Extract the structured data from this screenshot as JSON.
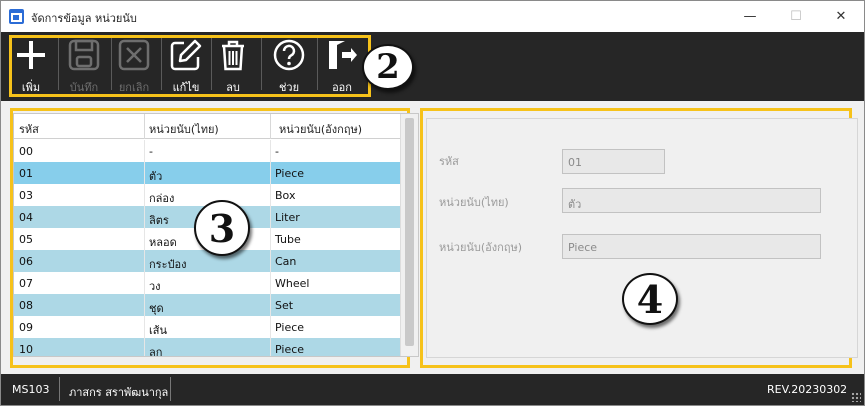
{
  "window": {
    "title": "จัดการข้อมูล หน่วยนับ",
    "minimize": "—",
    "maximize": "☐",
    "close": "✕"
  },
  "toolbar": [
    {
      "label": "เพิ่ม",
      "icon": "plus-icon",
      "enabled": true
    },
    {
      "label": "บันทึก",
      "icon": "save-icon",
      "enabled": false
    },
    {
      "label": "ยกเลิก",
      "icon": "cancel-icon",
      "enabled": false
    },
    {
      "label": "แก้ไข",
      "icon": "edit-icon",
      "enabled": true
    },
    {
      "label": "ลบ",
      "icon": "trash-icon",
      "enabled": true
    },
    {
      "label": "ช่วย",
      "icon": "help-icon",
      "enabled": true
    },
    {
      "label": "ออก",
      "icon": "exit-icon",
      "enabled": true
    }
  ],
  "callouts": {
    "c2": "2",
    "c3": "3",
    "c4": "4"
  },
  "grid": {
    "headers": [
      "รหัส",
      "หน่วยนับ(ไทย)",
      "หน่วยนับ(อังกฤษ)"
    ],
    "rows": [
      [
        "00",
        "-",
        "-"
      ],
      [
        "01",
        "ตัว",
        "Piece"
      ],
      [
        "03",
        "กล่อง",
        "Box"
      ],
      [
        "04",
        "ลิตร",
        "Liter"
      ],
      [
        "05",
        "หลอด",
        "Tube"
      ],
      [
        "06",
        "กระป๋อง",
        "Can"
      ],
      [
        "07",
        "วง",
        "Wheel"
      ],
      [
        "08",
        "ชุด",
        "Set"
      ],
      [
        "09",
        "เส้น",
        "Piece"
      ],
      [
        "10",
        "ลูก",
        "Piece"
      ]
    ],
    "selected_index": 1
  },
  "detail": {
    "code_label": "รหัส",
    "code_value": "01",
    "thai_label": "หน่วยนับ(ไทย)",
    "thai_value": "ตัว",
    "eng_label": "หน่วยนับ(อังกฤษ)",
    "eng_value": "Piece"
  },
  "status": {
    "form_code": "MS103",
    "user": "ภาสกร สราพัฒนากุล",
    "revision": "REV.20230302"
  },
  "colors": {
    "toolbar_bg": "#262626",
    "highlight": "#f6c21a",
    "row_alt": "#add8e6",
    "row_selected": "#87ceeb"
  }
}
